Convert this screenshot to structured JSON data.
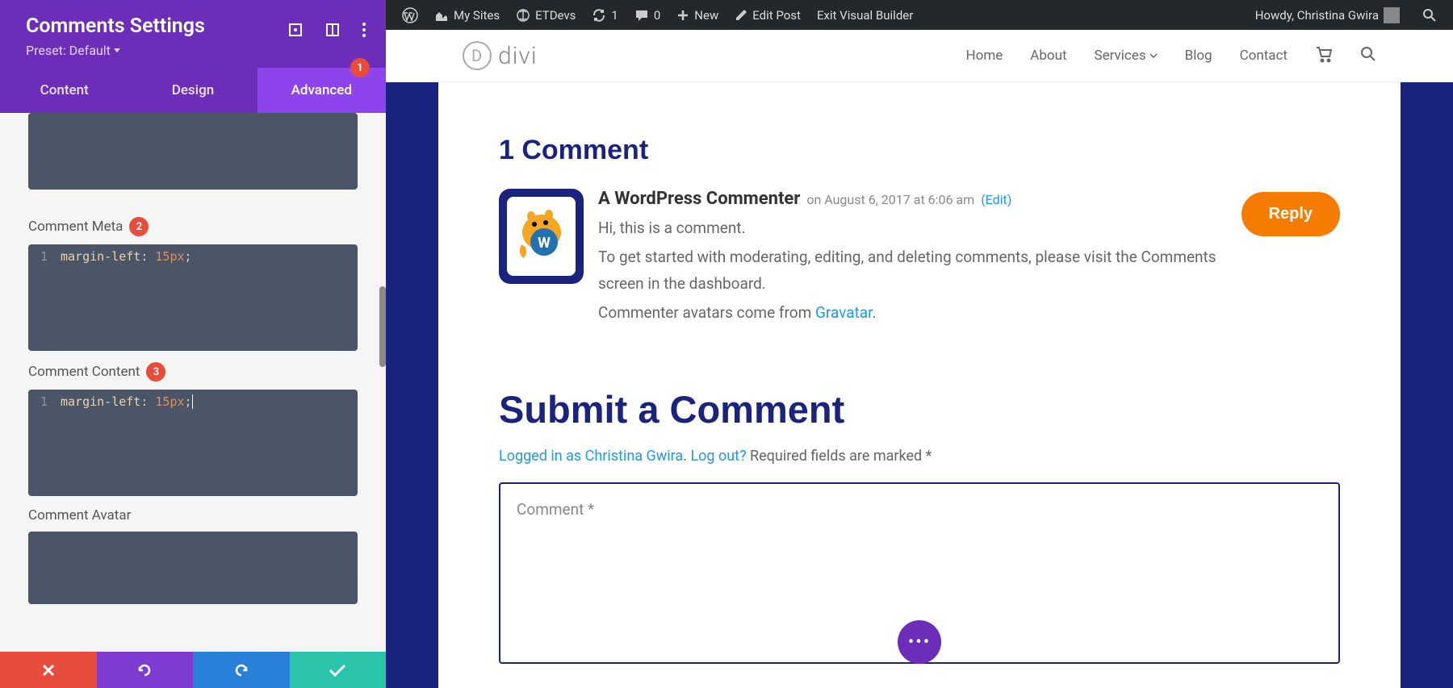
{
  "sidebar": {
    "title": "Comments Settings",
    "preset": "Preset: Default",
    "tabs": {
      "content": "Content",
      "design": "Design",
      "advanced": "Advanced",
      "advanced_badge": "1"
    },
    "fields": {
      "meta": {
        "label": "Comment Meta",
        "badge": "2",
        "line": "1",
        "prop": "margin-left",
        "val": "15px"
      },
      "content": {
        "label": "Comment Content",
        "badge": "3",
        "line": "1",
        "prop": "margin-left",
        "val": "15px"
      },
      "avatar": {
        "label": "Comment Avatar"
      }
    }
  },
  "wpbar": {
    "mysites": "My Sites",
    "etdevs": "ETDevs",
    "updates": "1",
    "comments": "0",
    "new": "New",
    "editpost": "Edit Post",
    "exitvb": "Exit Visual Builder",
    "howdy": "Howdy, Christina Gwira"
  },
  "header": {
    "logo_letter": "D",
    "logo_text": "divi",
    "nav": {
      "home": "Home",
      "about": "About",
      "services": "Services",
      "blog": "Blog",
      "contact": "Contact"
    }
  },
  "page": {
    "comments_heading": "1 Comment",
    "comment": {
      "author": "A WordPress Commenter",
      "date": "on August 6, 2017 at 6:06 am",
      "edit": "(Edit)",
      "line1": "Hi, this is a comment.",
      "line2": "To get started with moderating, editing, and deleting comments, please visit the Comments screen in the dashboard.",
      "line3a": "Commenter avatars come from ",
      "line3b": "Gravatar",
      "line3c": ".",
      "reply": "Reply"
    },
    "submit_heading": "Submit a Comment",
    "logged_in": "Logged in as Christina Gwira",
    "logout": "Log out?",
    "required": " Required fields are marked *",
    "textarea_placeholder": "Comment *",
    "fab": "•••"
  }
}
